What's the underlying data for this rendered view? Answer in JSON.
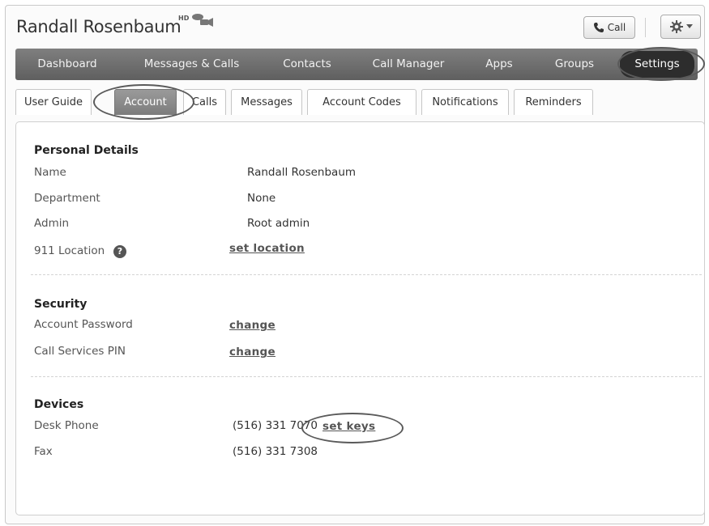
{
  "header": {
    "user_name": "Randall Rosenbaum",
    "hd_badge": "HD",
    "call_label": "Call"
  },
  "nav": {
    "items": [
      "Dashboard",
      "Messages & Calls",
      "Contacts",
      "Call Manager",
      "Apps",
      "Groups",
      "Settings"
    ],
    "active": "Settings"
  },
  "tabs": {
    "items": [
      "User Guide",
      "Account",
      "Calls",
      "Messages",
      "Account Codes",
      "Notifications",
      "Reminders"
    ],
    "active": "Account"
  },
  "personal": {
    "title": "Personal Details",
    "name_label": "Name",
    "name_value": "Randall Rosenbaum",
    "department_label": "Department",
    "department_value": "None",
    "admin_label": "Admin",
    "admin_value": "Root admin",
    "location_label": "911 Location",
    "help_glyph": "?",
    "location_link": "set location"
  },
  "security": {
    "title": "Security",
    "password_label": "Account Password",
    "password_link": "change",
    "pin_label": "Call Services PIN",
    "pin_link": "change"
  },
  "devices": {
    "title": "Devices",
    "desk_label": "Desk Phone",
    "desk_value": "(516) 331 7070",
    "desk_link": "set keys",
    "fax_label": "Fax",
    "fax_value": "(516) 331 7308"
  },
  "icons": {
    "video": "video-camera-icon",
    "phone": "phone-icon",
    "gear": "gear-icon",
    "caret": "chevron-down-icon",
    "help": "help-icon"
  },
  "colors": {
    "nav_bg": "#6e6e6e",
    "nav_active": "#2d2d2d",
    "tab_active": "#8a8a8a",
    "link": "#555555"
  }
}
